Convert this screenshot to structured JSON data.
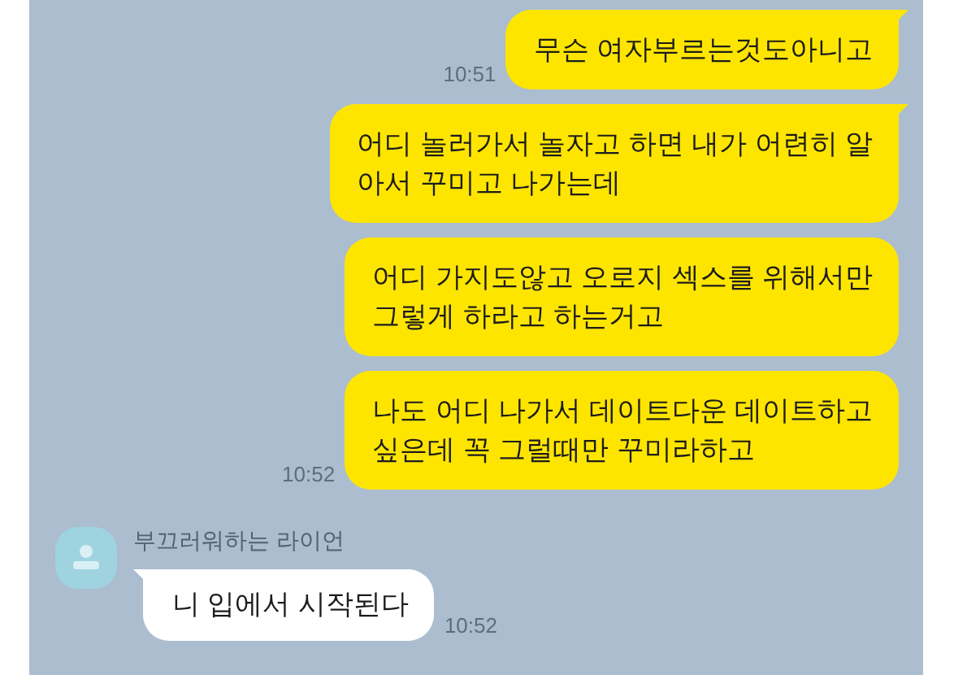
{
  "messages": [
    {
      "kind": "sent",
      "lines": [
        "무슨 여자부르는것도아니고"
      ],
      "time": "10:51",
      "tail": true
    },
    {
      "kind": "sent",
      "lines": [
        "어디 놀러가서 놀자고 하면 내가 어련히 알",
        "아서 꾸미고 나가는데"
      ],
      "tail": true
    },
    {
      "kind": "sent",
      "lines": [
        "어디 가지도않고 오로지 섹스를 위해서만",
        "그렇게 하라고 하는거고"
      ],
      "tail": false
    },
    {
      "kind": "sent",
      "lines": [
        "나도 어디 나가서 데이트다운 데이트하고",
        "싶은데 꼭 그럴때만 꾸미라하고"
      ],
      "time": "10:52",
      "tail": false
    },
    {
      "kind": "received",
      "sender": "부끄러워하는 라이언",
      "lines": [
        "니 입에서 시작된다"
      ],
      "time": "10:52",
      "tail": true
    }
  ]
}
